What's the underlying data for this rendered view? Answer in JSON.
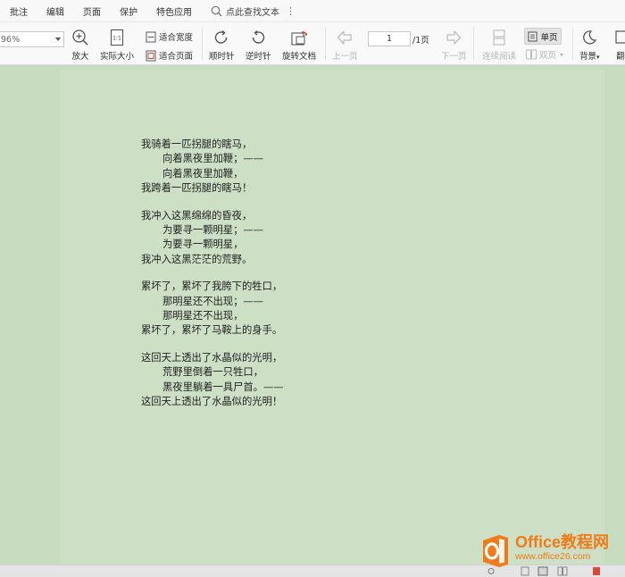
{
  "menu": {
    "items": [
      "批注",
      "编辑",
      "页面",
      "保护",
      "特色应用"
    ],
    "search_label": "点此查找文本",
    "more": "⋮"
  },
  "toolbar": {
    "zoom_value": "96%",
    "zoom_in": "放大",
    "actual_size": "实际大小",
    "actual_size_icon_text": "1:1",
    "fit_width": "适合宽度",
    "fit_page": "适合页面",
    "rotate_cw": "顺时针",
    "rotate_ccw": "逆时针",
    "rotate_doc": "旋转文档",
    "prev_page": "上一页",
    "page_current": "1",
    "page_total": "/1页",
    "next_page": "下一页",
    "continuous": "连续阅读",
    "single": "单页",
    "double": "双页",
    "background": "背景",
    "translate_partial": "翻"
  },
  "poem": {
    "stanzas": [
      [
        {
          "text": "我骑着一匹拐腿的瞎马，",
          "indent": false
        },
        {
          "text": "向着黑夜里加鞭；——",
          "indent": true
        },
        {
          "text": "向着黑夜里加鞭，",
          "indent": true
        },
        {
          "text": "我跨着一匹拐腿的瞎马！",
          "indent": false
        }
      ],
      [
        {
          "text": "我冲入这黑绵绵的昏夜，",
          "indent": false
        },
        {
          "text": "为要寻一颗明星；——",
          "indent": true
        },
        {
          "text": "为要寻一颗明星，",
          "indent": true
        },
        {
          "text": "我冲入这黑茫茫的荒野。",
          "indent": false
        }
      ],
      [
        {
          "text": "累坏了，累坏了我胯下的牲口，",
          "indent": false
        },
        {
          "text": "那明星还不出现；——",
          "indent": true
        },
        {
          "text": "那明星还不出现，",
          "indent": true
        },
        {
          "text": "累坏了，累坏了马鞍上的身手。",
          "indent": false
        }
      ],
      [
        {
          "text": "这回天上透出了水晶似的光明，",
          "indent": false
        },
        {
          "text": "荒野里倒着一只牲口，",
          "indent": true
        },
        {
          "text": "黑夜里躺着一具尸首。——",
          "indent": true
        },
        {
          "text": "这回天上透出了水晶似的光明！",
          "indent": false
        }
      ]
    ]
  },
  "watermark": {
    "title": "Office教程网",
    "url": "www.office26.com"
  },
  "colors": {
    "accent": "#f07b1a",
    "doc_background": "#c8dcc0",
    "page_background": "#cde0c6"
  }
}
